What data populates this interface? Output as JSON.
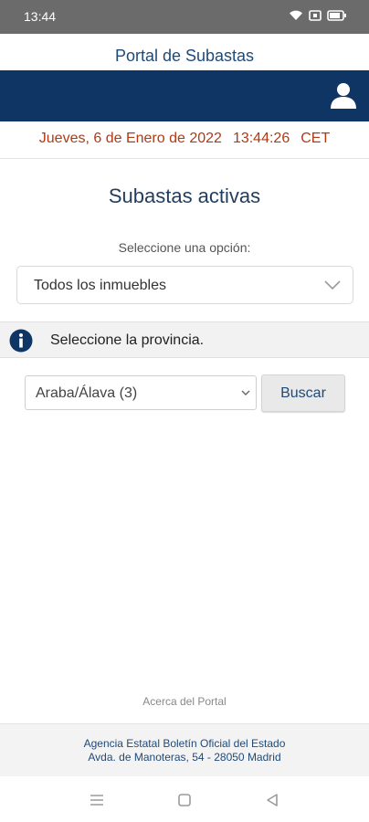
{
  "status_bar": {
    "time": "13:44",
    "icons": [
      "wifi-icon",
      "screen-record-icon",
      "battery-icon"
    ]
  },
  "app": {
    "title": "Portal de Subastas",
    "header_color": "#0f3565",
    "user_icon": "user-icon"
  },
  "datetime": {
    "date": "Jueves, 6 de Enero de 2022",
    "time": "13:44:26",
    "timezone": "CET",
    "color": "#b03a14"
  },
  "main": {
    "heading": "Subastas activas",
    "select_label": "Seleccione una opción:",
    "option_select": {
      "value": "Todos los inmuebles"
    },
    "info": {
      "icon": "info-icon",
      "text": "Seleccione la provincia."
    },
    "province_select": {
      "value": "Araba/Álava (3)"
    },
    "search_button": "Buscar"
  },
  "about_link": "Acerca del Portal",
  "footer": {
    "line1": "Agencia Estatal Boletín Oficial del Estado",
    "line2": "Avda. de Manoteras, 54 - 28050 Madrid"
  },
  "navigation": {
    "buttons": [
      "menu-icon",
      "home-icon",
      "back-icon"
    ]
  }
}
